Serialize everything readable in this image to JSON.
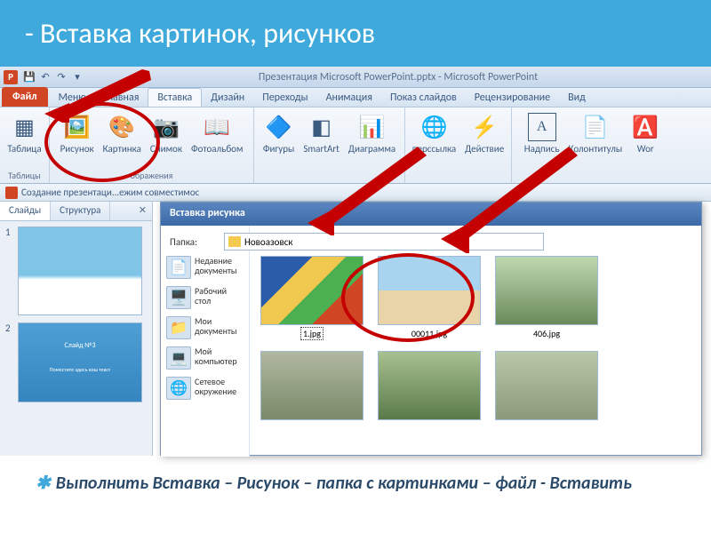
{
  "slide": {
    "title": "- Вставка картинок, рисунков"
  },
  "qat": {
    "app_title": "Презентация Microsoft PowerPoint.pptx - Microsoft PowerPoint"
  },
  "tabs": {
    "file": "Файл",
    "menu": "Меню",
    "home": "Главная",
    "insert": "Вставка",
    "design": "Дизайн",
    "transitions": "Переходы",
    "anim": "Анимация",
    "show": "Показ слайдов",
    "review": "Рецензирование",
    "view": "Вид"
  },
  "ribbon": {
    "table": "Таблица",
    "picture": "Рисунок",
    "clipart": "Картинка",
    "snapshot": "Снимок",
    "album": "Фотоальбом",
    "shapes": "Фигуры",
    "smartart": "SmartArt",
    "chart": "Диаграмма",
    "hyperlink": "перссылка",
    "action": "Действие",
    "textbox": "Надпись",
    "headerfooter": "Колонтитулы",
    "wordart": "Wor",
    "group_tables": "Таблицы",
    "group_images": "ображения"
  },
  "docbar": {
    "name": "Создание презентаци...ежим совместимос"
  },
  "panel": {
    "slides": "Слайды",
    "outline": "Структура",
    "t2_title": "Слайд №3",
    "t2_sub": "Поместите здесь ваш текст"
  },
  "dialog": {
    "title": "Вставка рисунка",
    "folder_label": "Папка:",
    "folder_name": "Новоазовск",
    "places": {
      "recent": "Недавние документы",
      "desktop": "Рабочий стол",
      "mydocs": "Мои документы",
      "mycomp": "Мой компьютер",
      "network": "Сетевое окружение"
    },
    "files": {
      "f1": "1.jpg",
      "f2": "00011.jpg",
      "f3": "406.jpg"
    }
  },
  "caption": {
    "text": "Выполнить Вставка – Рисунок – папка с картинками – файл  - Вставить"
  }
}
